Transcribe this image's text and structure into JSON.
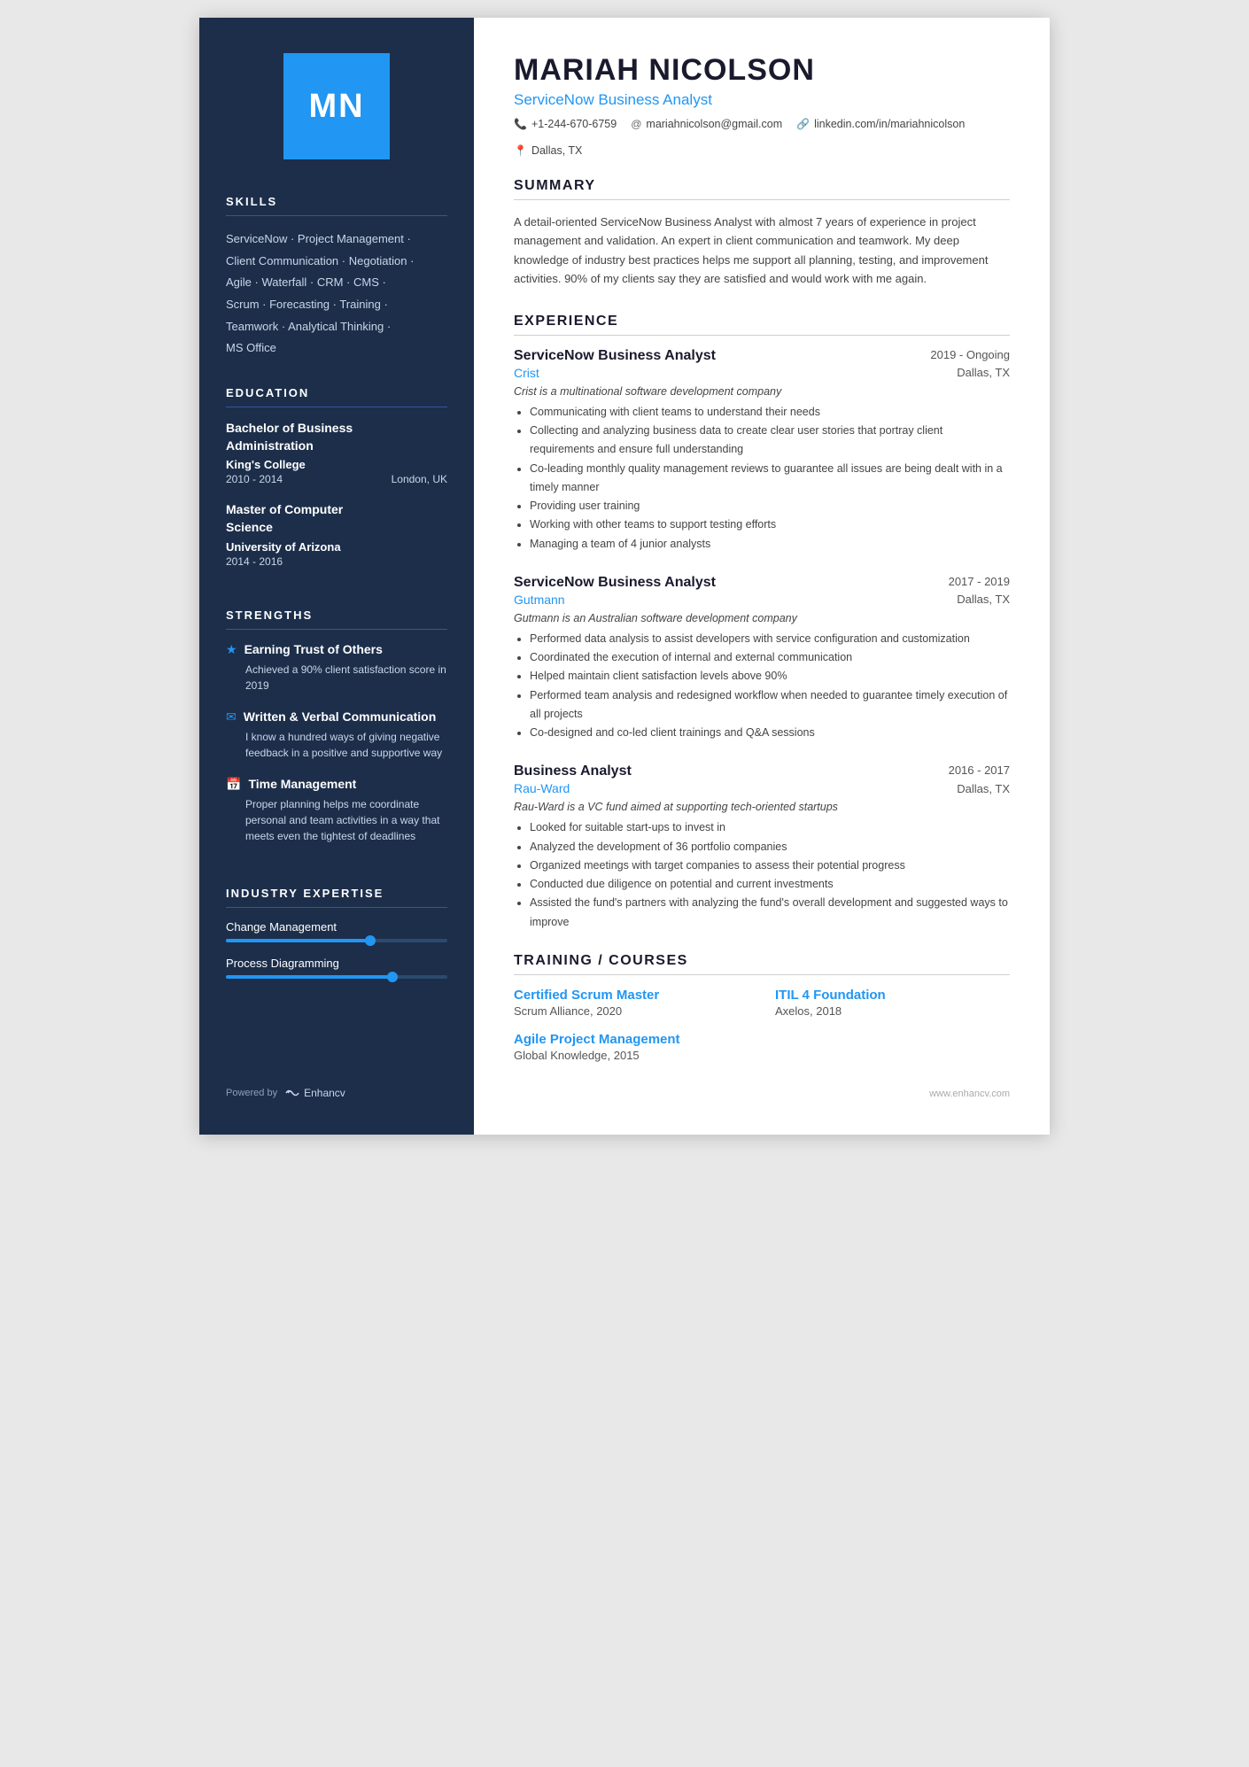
{
  "sidebar": {
    "initials": "MN",
    "sections": {
      "skills": {
        "title": "SKILLS",
        "text": "ServiceNow · Project Management ·\nClient Communication · Negotiation ·\nAgile · Waterfall · CRM · CMS ·\nScrum · Forecasting · Training ·\nTeamwork · Analytical Thinking ·\nMS Office"
      },
      "education": {
        "title": "EDUCATION",
        "items": [
          {
            "degree": "Bachelor of Business Administration",
            "school": "King's College",
            "years": "2010 - 2014",
            "location": "London, UK"
          },
          {
            "degree": "Master of Computer Science",
            "school": "University of Arizona",
            "years": "2014 - 2016",
            "location": ""
          }
        ]
      },
      "strengths": {
        "title": "STRENGTHS",
        "items": [
          {
            "icon": "★",
            "title": "Earning Trust of Others",
            "desc": "Achieved a 90% client satisfaction score in 2019"
          },
          {
            "icon": "✉",
            "title": "Written & Verbal Communication",
            "desc": "I know a hundred ways of giving negative feedback in a positive and supportive way"
          },
          {
            "icon": "📅",
            "title": "Time Management",
            "desc": "Proper planning helps me coordinate personal and team activities in a way that meets even the tightest of deadlines"
          }
        ]
      },
      "expertise": {
        "title": "INDUSTRY EXPERTISE",
        "items": [
          {
            "label": "Change Management",
            "fill_pct": 65
          },
          {
            "label": "Process Diagramming",
            "fill_pct": 75
          }
        ]
      }
    }
  },
  "main": {
    "name": "MARIAH NICOLSON",
    "job_title": "ServiceNow Business Analyst",
    "contact": {
      "phone": "+1-244-670-6759",
      "email": "mariahnicolson@gmail.com",
      "linkedin": "linkedin.com/in/mariahnicolson",
      "location": "Dallas, TX"
    },
    "summary": {
      "title": "SUMMARY",
      "text": "A detail-oriented ServiceNow Business Analyst with almost 7 years of experience in project management and validation. An expert in client communication and teamwork. My deep knowledge of industry best practices helps me support all planning, testing, and improvement activities. 90% of my clients say they are satisfied and would work with me again."
    },
    "experience": {
      "title": "EXPERIENCE",
      "items": [
        {
          "job_title": "ServiceNow Business Analyst",
          "dates": "2019 - Ongoing",
          "company": "Crist",
          "location": "Dallas, TX",
          "description": "Crist is a multinational software development company",
          "bullets": [
            "Communicating with client teams to understand their needs",
            "Collecting and analyzing business data to create clear user stories that portray client requirements and ensure full understanding",
            "Co-leading monthly quality management reviews to guarantee all issues are being dealt with in a timely manner",
            "Providing user training",
            "Working with other teams to support testing efforts",
            "Managing a team of 4 junior analysts"
          ]
        },
        {
          "job_title": "ServiceNow Business Analyst",
          "dates": "2017 - 2019",
          "company": "Gutmann",
          "location": "Dallas, TX",
          "description": "Gutmann is an Australian software development company",
          "bullets": [
            "Performed data analysis to assist developers with service configuration and customization",
            "Coordinated the execution of internal and external communication",
            "Helped maintain client satisfaction levels above 90%",
            "Performed team analysis and redesigned workflow when needed to guarantee timely execution of all projects",
            "Co-designed and co-led client trainings and Q&A sessions"
          ]
        },
        {
          "job_title": "Business Analyst",
          "dates": "2016 - 2017",
          "company": "Rau-Ward",
          "location": "Dallas, TX",
          "description": "Rau-Ward is a VC fund aimed at supporting tech-oriented startups",
          "bullets": [
            "Looked for suitable start-ups to invest in",
            "Analyzed the development of 36 portfolio companies",
            "Organized meetings with target companies to assess their potential progress",
            "Conducted due diligence on potential and current investments",
            "Assisted the fund's partners with analyzing the fund's overall development and suggested ways to improve"
          ]
        }
      ]
    },
    "training": {
      "title": "TRAINING / COURSES",
      "items": [
        {
          "name": "Certified Scrum Master",
          "meta": "Scrum Alliance, 2020"
        },
        {
          "name": "ITIL 4 Foundation",
          "meta": "Axelos, 2018"
        },
        {
          "name": "Agile Project Management",
          "meta": "Global Knowledge, 2015"
        }
      ]
    }
  },
  "footer": {
    "powered_by": "Powered by",
    "brand": "Enhancv",
    "website": "www.enhancv.com"
  }
}
